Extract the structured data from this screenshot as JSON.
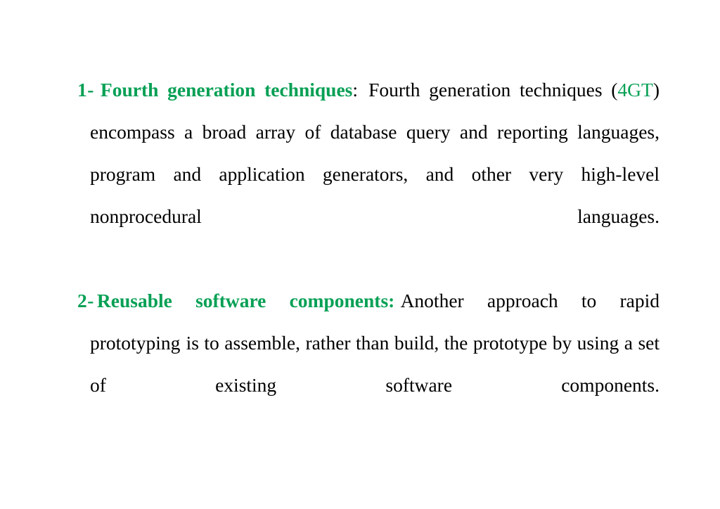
{
  "slide": {
    "background_color": "#ffffff",
    "accent_color": "#07A055",
    "text_color": "#000000",
    "items": [
      {
        "marker": "1-",
        "lead": "Fourth generation techniques",
        "lead_separator": ":",
        "lead_separator_color": "#000000",
        "body_part_1": "Fourth generation techniques (",
        "accent_inline": "4GT",
        "body_part_2": ") encompass a broad array of database query and reporting languages, program and application generators, and other very high-level nonprocedural languages.",
        "full_text": "1- Fourth generation techniques: Fourth generation techniques (4GT) encompass a broad array of database query and reporting languages, program and application generators, and other very high-level nonprocedural languages."
      },
      {
        "marker": "2-",
        "lead": "Reusable software components:",
        "lead_separator": "",
        "lead_separator_color": "#07A055",
        "body_part_1": "Another approach to rapid prototyping",
        "accent_inline": "",
        "body_part_2": "is to assemble, rather than build, the prototype by    using a set of    existing software components.",
        "full_text": "2- Reusable software components: Another approach to rapid prototyping  is to assemble, rather than build, the prototype by  using a set of  existing software components."
      }
    ]
  }
}
